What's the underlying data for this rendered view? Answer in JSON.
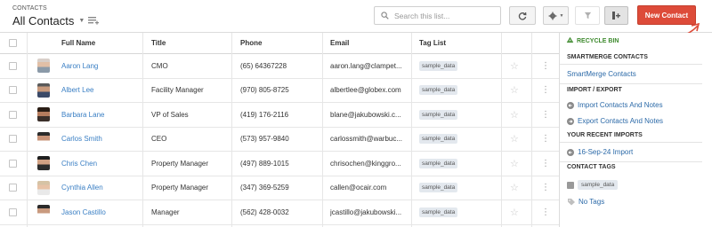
{
  "header": {
    "breadcrumb": "CONTACTS",
    "title": "All Contacts",
    "search_placeholder": "Search this list...",
    "new_button": "New Contact"
  },
  "table": {
    "columns": [
      "Full Name",
      "Title",
      "Phone",
      "Email",
      "Tag List"
    ],
    "rows": [
      {
        "name": "Aaron Lang",
        "title": "CMO",
        "phone": "(65) 64367228",
        "email": "aaron.lang@clampet...",
        "tag": "sample_data"
      },
      {
        "name": "Albert Lee",
        "title": "Facility Manager",
        "phone": "(970) 805-8725",
        "email": "albertlee@globex.com",
        "tag": "sample_data"
      },
      {
        "name": "Barbara Lane",
        "title": "VP of Sales",
        "phone": "(419) 176-2116",
        "email": "blane@jakubowski.c...",
        "tag": "sample_data"
      },
      {
        "name": "Carlos Smith",
        "title": "CEO",
        "phone": "(573) 957-9840",
        "email": "carlossmith@warbuc...",
        "tag": "sample_data"
      },
      {
        "name": "Chris Chen",
        "title": "Property Manager",
        "phone": "(497) 889-1015",
        "email": "chrisochen@kinggro...",
        "tag": "sample_data"
      },
      {
        "name": "Cynthia Allen",
        "title": "Property Manager",
        "phone": "(347) 369-5259",
        "email": "callen@ocair.com",
        "tag": "sample_data"
      },
      {
        "name": "Jason Castillo",
        "title": "Manager",
        "phone": "(562) 428-0032",
        "email": "jcastillo@jakubowski...",
        "tag": "sample_data"
      }
    ]
  },
  "sidebar": {
    "recycle_bin": "RECYCLE BIN",
    "smartmerge_heading": "SMARTMERGE CONTACTS",
    "smartmerge_link": "SmartMerge Contacts",
    "import_export_heading": "IMPORT / EXPORT",
    "import_link": "Import Contacts And Notes",
    "export_link": "Export Contacts And Notes",
    "recent_imports_heading": "YOUR RECENT IMPORTS",
    "recent_import": "16-Sep-24 Import",
    "contact_tags_heading": "CONTACT TAGS",
    "tag": "sample_data",
    "no_tags": "No Tags"
  },
  "colors": {
    "accent_red": "#dd4b39",
    "link_blue": "#3a7fc4",
    "recycle_green": "#3e8a2e"
  }
}
